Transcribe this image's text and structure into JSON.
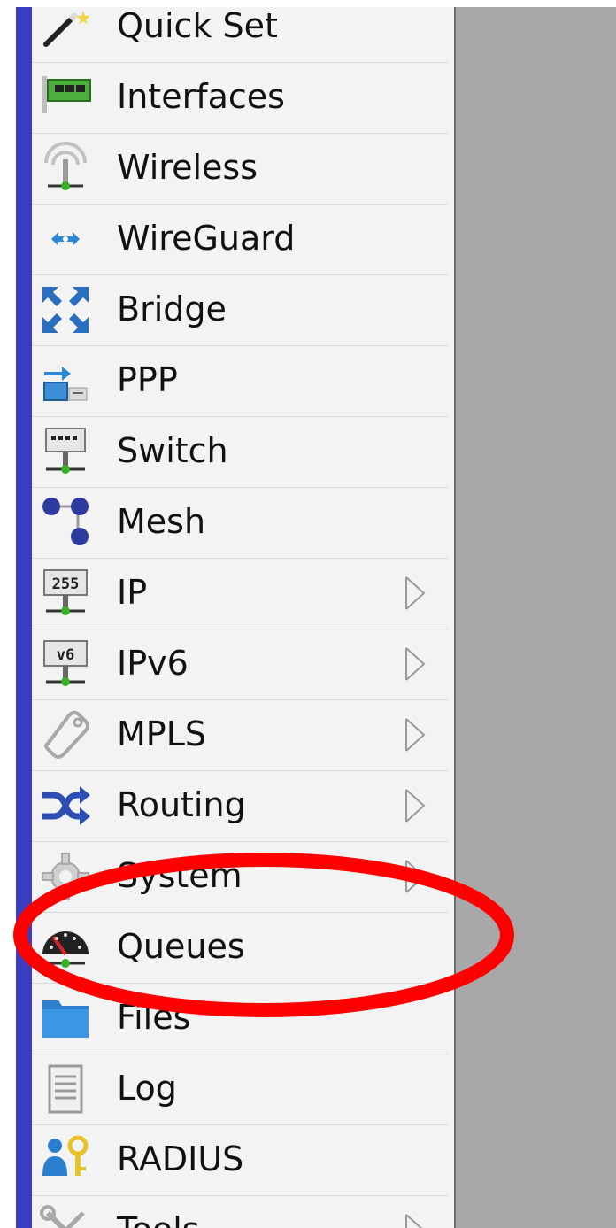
{
  "menu": {
    "items": [
      {
        "label": "Quick Set",
        "icon": "wand-icon",
        "submenu": false
      },
      {
        "label": "Interfaces",
        "icon": "network-card-icon",
        "submenu": false
      },
      {
        "label": "Wireless",
        "icon": "wireless-antenna-icon",
        "submenu": false
      },
      {
        "label": "WireGuard",
        "icon": "wireguard-icon",
        "submenu": false
      },
      {
        "label": "Bridge",
        "icon": "bridge-arrows-icon",
        "submenu": false
      },
      {
        "label": "PPP",
        "icon": "ppp-icon",
        "submenu": false
      },
      {
        "label": "Switch",
        "icon": "switch-icon",
        "submenu": false
      },
      {
        "label": "Mesh",
        "icon": "mesh-icon",
        "submenu": false
      },
      {
        "label": "IP",
        "icon": "ip-255-icon",
        "submenu": true
      },
      {
        "label": "IPv6",
        "icon": "ipv6-icon",
        "submenu": true
      },
      {
        "label": "MPLS",
        "icon": "mpls-tag-icon",
        "submenu": true
      },
      {
        "label": "Routing",
        "icon": "routing-arrows-icon",
        "submenu": true
      },
      {
        "label": "System",
        "icon": "gear-icon",
        "submenu": true
      },
      {
        "label": "Queues",
        "icon": "gauge-icon",
        "submenu": false
      },
      {
        "label": "Files",
        "icon": "folder-icon",
        "submenu": false
      },
      {
        "label": "Log",
        "icon": "document-icon",
        "submenu": false
      },
      {
        "label": "RADIUS",
        "icon": "users-key-icon",
        "submenu": false
      },
      {
        "label": "Tools",
        "icon": "tools-icon",
        "submenu": true
      }
    ]
  },
  "icon_text": {
    "ip": "255",
    "ipv6": "v6"
  },
  "annotation": {
    "highlighted_item": "Queues",
    "color": "#ff0000"
  },
  "colors": {
    "accent_bar": "#3c3cc0",
    "menu_bg": "#f3f3f3",
    "right_pane": "#a8a8a8"
  }
}
